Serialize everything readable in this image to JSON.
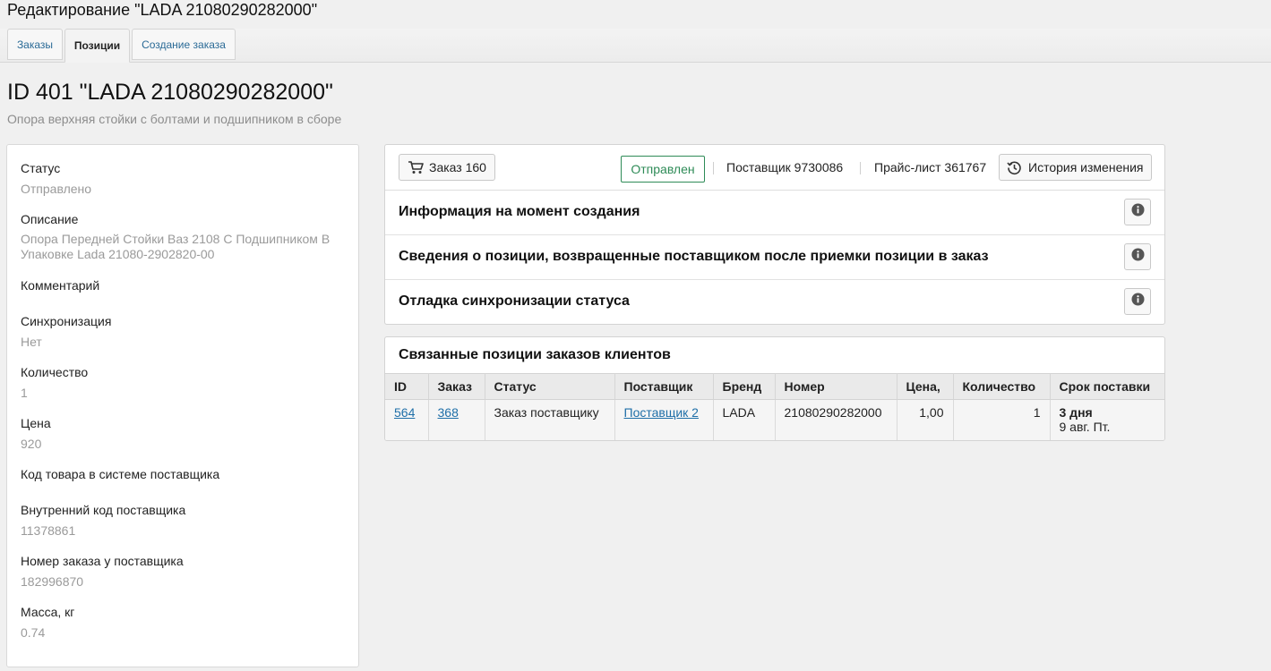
{
  "window": {
    "title": "Редактирование \"LADA 21080290282000\""
  },
  "tabs": [
    {
      "label": "Заказы",
      "active": false
    },
    {
      "label": "Позиции",
      "active": true
    },
    {
      "label": "Создание заказа",
      "active": false
    }
  ],
  "page": {
    "title": "ID 401 \"LADA 21080290282000\"",
    "subtitle": "Опора верхняя стойки с болтами и подшипником в сборе"
  },
  "details": {
    "status_label": "Статус",
    "status_value": "Отправлено",
    "description_label": "Описание",
    "description_value": "Опора Передней Стойки Ваз 2108 С Подшипником В Упаковке Lada 21080-2902820-00",
    "comment_label": "Комментарий",
    "sync_label": "Синхронизация",
    "sync_value": "Нет",
    "quantity_label": "Количество",
    "quantity_value": "1",
    "price_label": "Цена",
    "price_value": "920",
    "supplier_product_code_label": "Код товара в системе поставщика",
    "supplier_internal_code_label": "Внутренний код поставщика",
    "supplier_internal_code_value": "11378861",
    "supplier_order_number_label": "Номер заказа у поставщика",
    "supplier_order_number_value": "182996870",
    "mass_label": "Масса, кг",
    "mass_value": "0.74"
  },
  "toolbar": {
    "order_button": "Заказ 160",
    "order_icon": "cart-icon",
    "status_badge": "Отправлен",
    "supplier_text": "Поставщик 9730086",
    "pricelist_text": "Прайс-лист 361767",
    "history_button": "История изменения",
    "history_icon": "history-icon",
    "status_color": "#2e8b57"
  },
  "sections": [
    {
      "title": "Информация на момент создания",
      "icon": "info-icon"
    },
    {
      "title": "Сведения о позиции, возвращенные поставщиком после приемки позиции в заказ",
      "icon": "info-icon"
    },
    {
      "title": "Отладка синхронизации статуса",
      "icon": "info-icon"
    }
  ],
  "related": {
    "title": "Связанные позиции заказов клиентов",
    "columns": [
      "ID",
      "Заказ",
      "Статус",
      "Поставщик",
      "Бренд",
      "Номер",
      "Цена,",
      "Количество",
      "Срок поставки"
    ],
    "rows": [
      {
        "id": "564",
        "order": "368",
        "status": "Заказ поставщику",
        "supplier": "Поставщик 2",
        "brand": "LADA",
        "number": "21080290282000",
        "price": "1,00",
        "quantity": "1",
        "delivery_term": "3 дня",
        "delivery_date": "9 авг. Пт."
      }
    ]
  },
  "colors": {
    "link": "#1f6fa8",
    "background": "#f0f0f0"
  }
}
